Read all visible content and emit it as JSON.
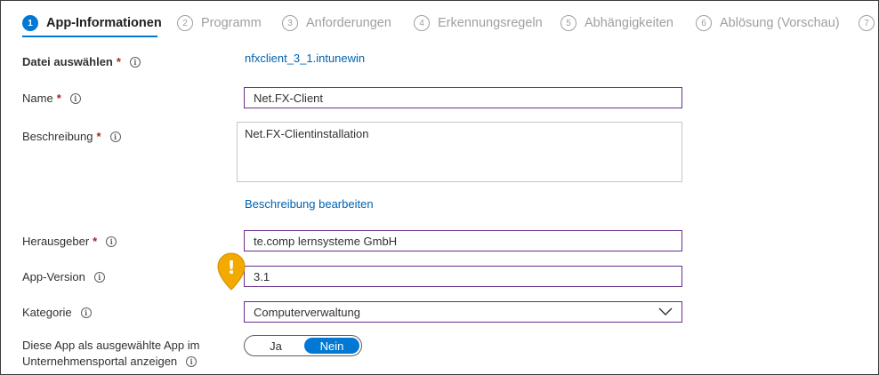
{
  "tabs": [
    {
      "number": "1",
      "label": "App-Informationen",
      "active": true
    },
    {
      "number": "2",
      "label": "Programm"
    },
    {
      "number": "3",
      "label": "Anforderungen"
    },
    {
      "number": "4",
      "label": "Erkennungsregeln"
    },
    {
      "number": "5",
      "label": "Abhängigkeiten"
    },
    {
      "number": "6",
      "label": "Ablösung (Vorschau)"
    },
    {
      "number": "7",
      "label": ""
    }
  ],
  "form": {
    "file": {
      "label": "Datei auswählen",
      "value": "nfxclient_3_1.intunewin"
    },
    "name": {
      "label": "Name",
      "value": "Net.FX-Client"
    },
    "description": {
      "label": "Beschreibung",
      "value": "Net.FX-Clientinstallation",
      "edit_link": "Beschreibung bearbeiten"
    },
    "publisher": {
      "label": "Herausgeber",
      "value": "te.comp lernsysteme GmbH"
    },
    "version": {
      "label": "App-Version",
      "value": "3.1"
    },
    "category": {
      "label": "Kategorie",
      "value": "Computerverwaltung"
    },
    "featured": {
      "label_line1": "Diese App als ausgewählte App im",
      "label_line2": "Unternehmensportal anzeigen",
      "option_yes": "Ja",
      "option_no": "Nein",
      "selected": "Nein"
    }
  },
  "required_mark": "*",
  "info_glyph": "i",
  "warning_glyph": "!",
  "colors": {
    "accent": "#0078d4",
    "link": "#0063b1",
    "required": "#a4262c",
    "input_border": "#6b2e8f",
    "warning": "#f2a900"
  }
}
